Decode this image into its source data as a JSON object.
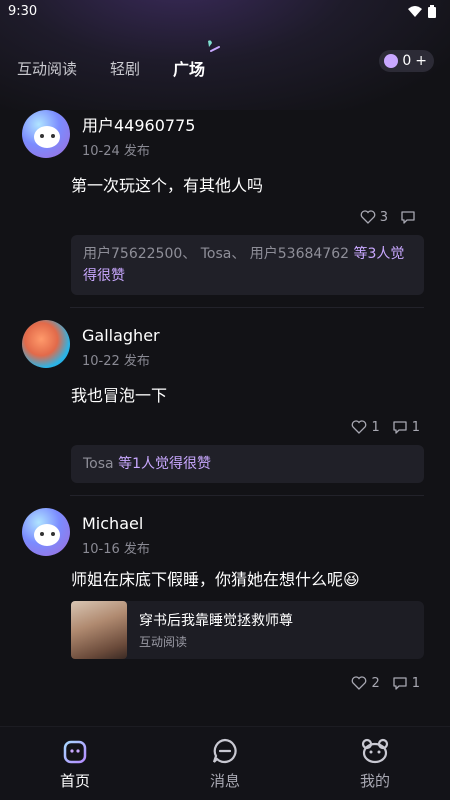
{
  "status": {
    "time": "9:30"
  },
  "tabs": [
    {
      "label": "互动阅读"
    },
    {
      "label": "轻剧"
    },
    {
      "label": "广场"
    }
  ],
  "coins": {
    "count": "0",
    "plus": "+"
  },
  "posts": [
    {
      "user": "用户44960775",
      "date": "10-24 发布",
      "content": "第一次玩这个，有其他人吗",
      "likes": "3",
      "comments": "",
      "liked_by": "用户75622500、 Tosa、 用户53684762",
      "liked_suffix": "等3人觉得很赞"
    },
    {
      "user": "Gallagher",
      "date": "10-22 发布",
      "content": "我也冒泡一下",
      "likes": "1",
      "comments": "1",
      "liked_by": "Tosa",
      "liked_suffix": "等1人觉得很赞"
    },
    {
      "user": "Michael",
      "date": "10-16 发布",
      "content": "师姐在床底下假睡，你猜她在想什么呢😆",
      "likes": "2",
      "comments": "1",
      "book_title": "穿书后我靠睡觉拯救师尊",
      "book_sub": "互动阅读"
    }
  ],
  "bottom_nav": [
    {
      "label": "首页"
    },
    {
      "label": "消息"
    },
    {
      "label": "我的"
    }
  ],
  "colors": {
    "accent": "#c9a8ff",
    "background": "#121216"
  }
}
